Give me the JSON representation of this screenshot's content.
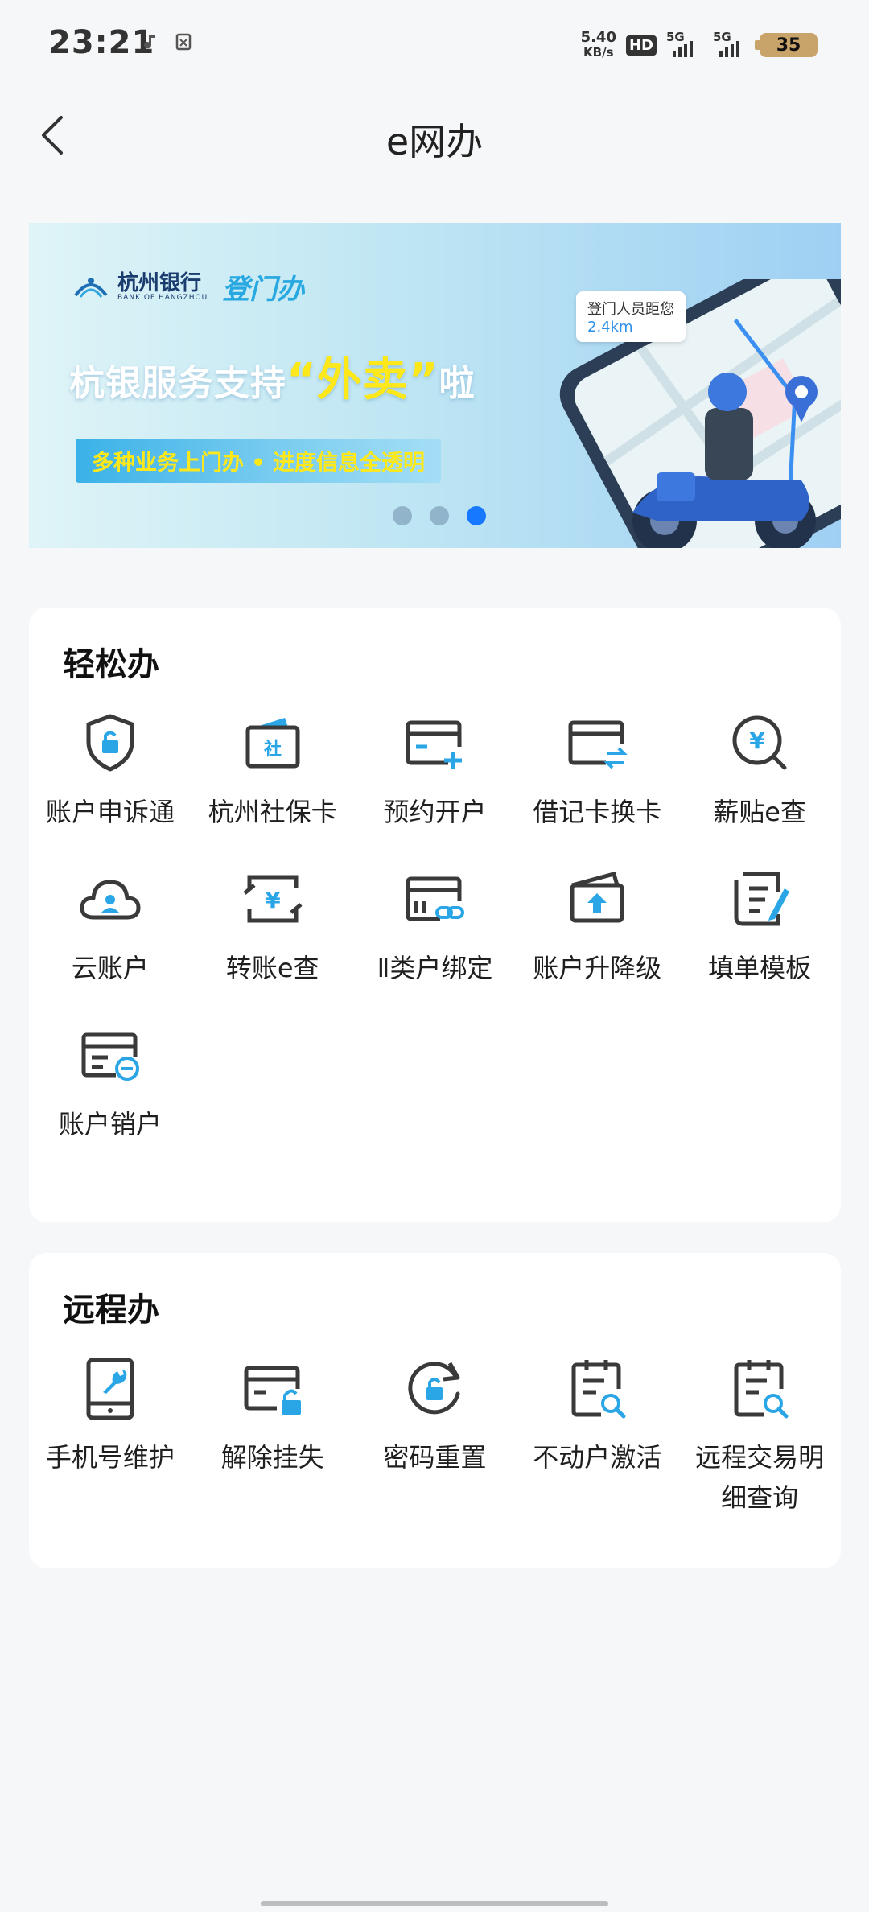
{
  "status_bar": {
    "time": "23:21",
    "net_speed_value": "5.40",
    "net_speed_unit": "KB/s",
    "hd_label": "HD",
    "sim1": "5G",
    "sim2": "5G",
    "battery_level": "35"
  },
  "header": {
    "title": "e网办"
  },
  "banner": {
    "bank_name": "杭州银行",
    "bank_sub": "BANK OF HANGZHOU",
    "brand_tag": "登门办",
    "headline_pre": "杭银服务支持",
    "headline_quote": "“外卖”",
    "headline_post": "啦",
    "subline": "多种业务上门办 • 进度信息全透明",
    "callout_line1": "登门人员距您",
    "callout_line2": "2.4km",
    "slide_count": 3,
    "active_slide": 3
  },
  "easy_section": {
    "title": "轻松办",
    "items": [
      {
        "label": "账户申诉通",
        "icon": "shield-lock-icon"
      },
      {
        "label": "杭州社保卡",
        "icon": "social-card-icon"
      },
      {
        "label": "预约开户",
        "icon": "card-add-icon"
      },
      {
        "label": "借记卡换卡",
        "icon": "card-exchange-icon"
      },
      {
        "label": "薪贴e查",
        "icon": "salary-search-icon"
      },
      {
        "label": "云账户",
        "icon": "cloud-user-icon"
      },
      {
        "label": "转账e查",
        "icon": "transfer-search-icon"
      },
      {
        "label": "Ⅱ类户绑定",
        "icon": "card-link-icon"
      },
      {
        "label": "账户升降级",
        "icon": "wallet-up-icon"
      },
      {
        "label": "填单模板",
        "icon": "form-edit-icon"
      },
      {
        "label": "账户销户",
        "icon": "card-cancel-icon"
      }
    ]
  },
  "remote_section": {
    "title": "远程办",
    "items": [
      {
        "label": "手机号维护",
        "icon": "phone-wrench-icon"
      },
      {
        "label": "解除挂失",
        "icon": "card-unlock-icon"
      },
      {
        "label": "密码重置",
        "icon": "lock-reset-icon"
      },
      {
        "label": "不动户激活",
        "icon": "clipboard-search-icon"
      },
      {
        "label": "远程交易明细查询",
        "icon": "clipboard-search-icon"
      }
    ]
  },
  "colors": {
    "accent": "#1677ff",
    "icon_dark": "#3a3a3a",
    "icon_blue": "#2aa6e6",
    "background": "#f6f7f8"
  }
}
